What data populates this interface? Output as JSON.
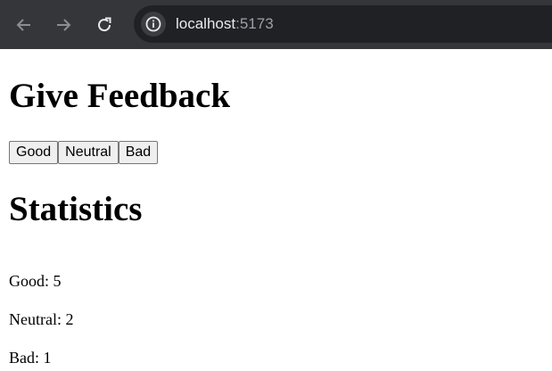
{
  "browser": {
    "url_host": "localhost",
    "url_port": ":5173",
    "icons": [
      "back-arrow-icon",
      "forward-arrow-icon",
      "reload-icon",
      "info-icon"
    ],
    "colors": {
      "toolbar": "#35363a",
      "omnibox": "#202124",
      "icon": "#9aa0a6"
    }
  },
  "page": {
    "feedback_title": "Give Feedback",
    "buttons": {
      "good": "Good",
      "neutral": "Neutral",
      "bad": "Bad"
    },
    "statistics_title": "Statistics",
    "stats": {
      "good": "Good: 5",
      "neutral": "Neutral: 2",
      "bad": "Bad: 1"
    }
  }
}
